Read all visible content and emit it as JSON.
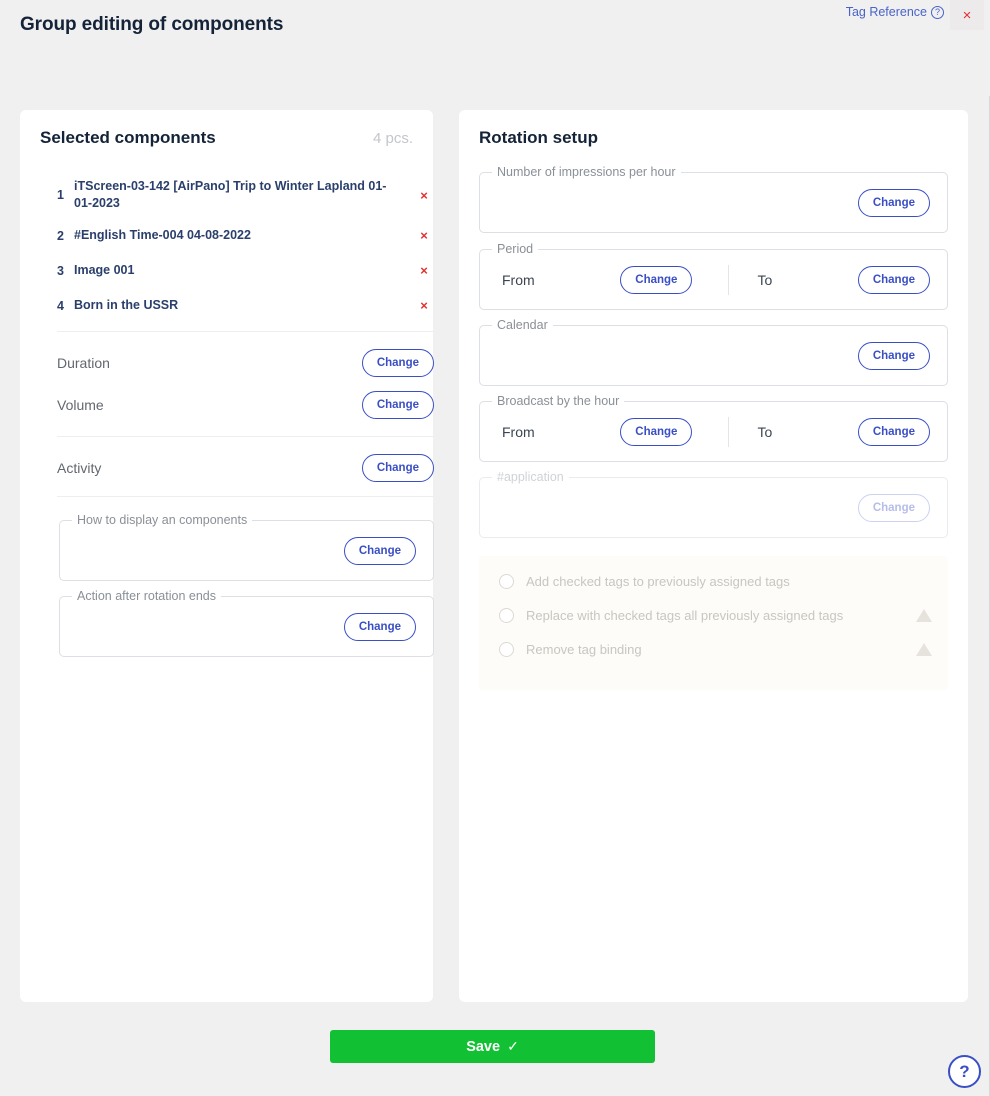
{
  "window": {
    "title": "Group editing of components",
    "tag_reference_label": "Tag Reference",
    "close_label": "×"
  },
  "left_panel": {
    "title": "Selected components",
    "count_label": "4 pcs.",
    "components": [
      {
        "index": "1",
        "name": "iTScreen-03-142 [AirPano] Trip to Winter Lapland 01-01-2023",
        "delete_label": "×"
      },
      {
        "index": "2",
        "name": "#English Time-004 04-08-2022",
        "delete_label": "×"
      },
      {
        "index": "3",
        "name": "Image 001",
        "delete_label": "×"
      },
      {
        "index": "4",
        "name": "Born in the USSR",
        "delete_label": "×"
      }
    ],
    "rows": [
      {
        "label": "Duration",
        "button": "Change"
      },
      {
        "label": "Volume",
        "button": "Change"
      },
      {
        "label": "Activity",
        "button": "Change"
      }
    ],
    "fieldsets": [
      {
        "legend": "How to display an components",
        "button": "Change"
      },
      {
        "legend": "Action after rotation ends",
        "button": "Change"
      }
    ]
  },
  "right_panel": {
    "title": "Rotation setup",
    "impressions": {
      "legend": "Number of impressions per hour",
      "button": "Change"
    },
    "period": {
      "legend": "Period",
      "from_label": "From",
      "from_button": "Change",
      "to_label": "To",
      "to_button": "Change"
    },
    "calendar": {
      "legend": "Calendar",
      "button": "Change"
    },
    "broadcast": {
      "legend": "Broadcast by the hour",
      "from_label": "From",
      "from_button": "Change",
      "to_label": "To",
      "to_button": "Change"
    },
    "application": {
      "legend": "#application",
      "button": "Change"
    },
    "tag_options": [
      {
        "label": "Add checked tags to previously assigned tags",
        "warning": false
      },
      {
        "label": "Replace with checked tags all previously assigned tags",
        "warning": true
      },
      {
        "label": "Remove tag binding",
        "warning": true
      }
    ]
  },
  "footer": {
    "save_label": "Save",
    "save_check": "✓",
    "help_label": "?"
  },
  "icons": {
    "question_circle": "?",
    "warning_triangle": "▲"
  },
  "colors": {
    "accent_blue": "#3a4fc4",
    "link_blue": "#4a63c8",
    "danger_red": "#e03131",
    "save_green": "#12c133",
    "title_navy": "#142338",
    "page_bg": "#f0f0f0",
    "radio_block_bg": "#fdfcf8"
  }
}
